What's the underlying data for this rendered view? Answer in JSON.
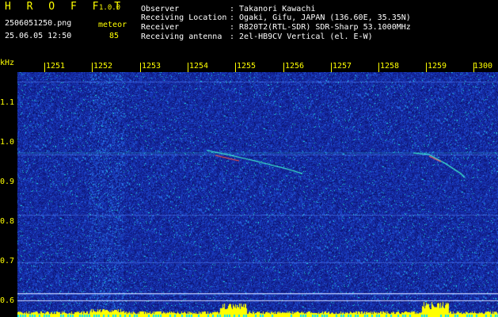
{
  "header": {
    "app_name": "H R O F F T",
    "version": "1.0.0",
    "filename": "2506051250.png",
    "datetime": "25.06.05 12:50",
    "mode_label": "meteor",
    "count": "85",
    "fields": [
      {
        "label": "Observer",
        "value": ": Takanori Kawachi"
      },
      {
        "label": "Receiving Location",
        "value": ": Ogaki, Gifu, JAPAN (136.60E, 35.35N)"
      },
      {
        "label": "Receiver",
        "value": ": R820T2(RTL-SDR) SDR-Sharp 53.1000MHz"
      },
      {
        "label": "Receiving antenna",
        "value": ": 2el-HB9CV Vertical (el. E-W)"
      }
    ]
  },
  "axes": {
    "y_unit": "kHz",
    "y_ticks": [
      "1.1",
      "1.0",
      "0.9",
      "0.8",
      "0.7",
      "0.6"
    ],
    "x_ticks": [
      "1251",
      "1252",
      "1253",
      "1254",
      "1255",
      "1256",
      "1257",
      "1258",
      "1259",
      "1300"
    ]
  },
  "colors": {
    "text_header": "#ffff00",
    "text_white": "#ffffff",
    "background": "#000000",
    "spectrogram_base": "#1a2a9a"
  }
}
